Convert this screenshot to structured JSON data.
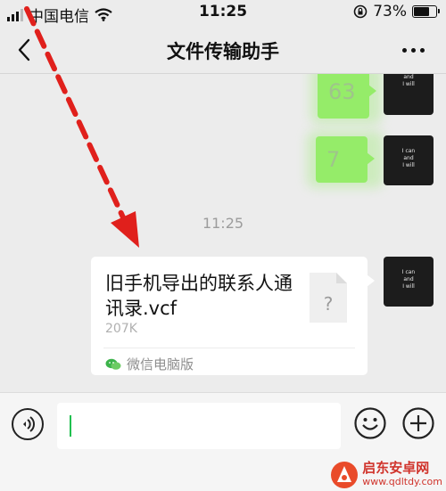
{
  "status_bar": {
    "carrier": "中国电信",
    "time": "11:25",
    "battery_percent": "73%",
    "battery_level": 0.73
  },
  "nav": {
    "title": "文件传输助手",
    "back_icon": "chevron-left-icon",
    "more_icon": "more-dots-icon"
  },
  "messages": {
    "bubble_1_text": "63",
    "bubble_2_text": "7",
    "avatar_lines": [
      "I can",
      "and",
      "I will"
    ],
    "timestamp": "11:25",
    "file": {
      "name": "旧手机导出的联系人通讯录.vcf",
      "size": "207K",
      "source": "微信电脑版",
      "icon_glyph": "?"
    }
  },
  "input_bar": {
    "value": "",
    "voice_icon": "voice-icon",
    "emoji_icon": "emoji-icon",
    "plus_icon": "plus-icon"
  },
  "watermark": {
    "name": "启东安卓网",
    "url": "www.qdltdy.com"
  },
  "colors": {
    "annotation_arrow": "#e0201c",
    "bubble_green": "#95ec69",
    "cursor_green": "#20c050"
  }
}
